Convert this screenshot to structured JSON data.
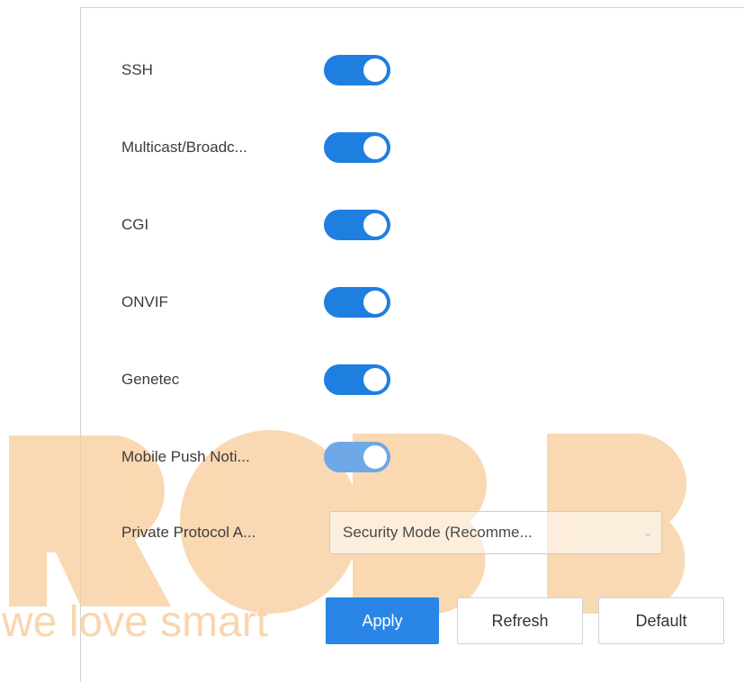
{
  "settings": {
    "rows": [
      {
        "label": "SSH",
        "enabled": true
      },
      {
        "label": "Multicast/Broadc...",
        "enabled": true
      },
      {
        "label": "CGI",
        "enabled": true
      },
      {
        "label": "ONVIF",
        "enabled": true
      },
      {
        "label": "Genetec",
        "enabled": true
      },
      {
        "label": "Mobile Push Noti...",
        "enabled": true
      }
    ],
    "private_protocol": {
      "label": "Private Protocol A...",
      "value": "Security Mode (Recomme..."
    }
  },
  "actions": {
    "apply_label": "Apply",
    "refresh_label": "Refresh",
    "default_label": "Default"
  },
  "watermark": {
    "text": "we love smart",
    "logo_text": "ROBB",
    "color": "#f8cfa0"
  },
  "colors": {
    "toggle_on": "#1f7fe0",
    "apply_bg": "#2a86e6"
  }
}
